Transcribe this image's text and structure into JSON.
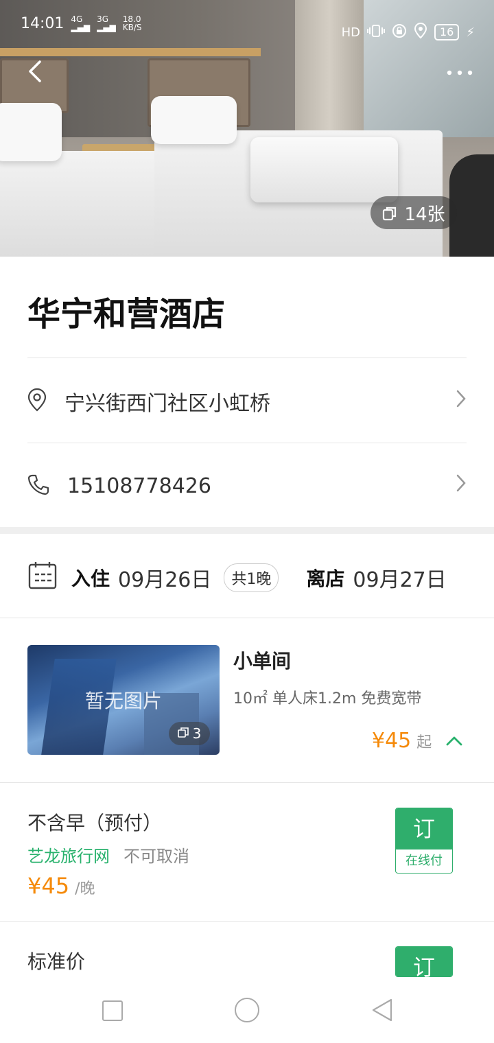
{
  "status_bar": {
    "time": "14:01",
    "signal1": "4G",
    "signal2": "3G",
    "speed": "18.0",
    "speed_unit": "KB/S",
    "hd": "HD",
    "battery": "16"
  },
  "hero": {
    "photo_count": "14张"
  },
  "hotel": {
    "name": "华宁和营酒店",
    "address": "宁兴街西门社区小虹桥",
    "phone": "15108778426"
  },
  "stay": {
    "checkin_label": "入住",
    "checkin_date": "09月26日",
    "nights": "共1晚",
    "checkout_label": "离店",
    "checkout_date": "09月27日"
  },
  "room": {
    "no_image_text": "暂无图片",
    "image_count": "3",
    "name": "小单间",
    "description": "10㎡ 单人床1.2m 免费宽带",
    "price": "¥45",
    "price_suffix": "起"
  },
  "plans": [
    {
      "name": "不含早（预付）",
      "provider": "艺龙旅行网",
      "cancel_policy": "不可取消",
      "price": "¥45",
      "price_unit": "/晚",
      "book_label": "订",
      "book_sub": "在线付"
    },
    {
      "name": "标准价",
      "book_label": "订"
    }
  ],
  "colors": {
    "accent_green": "#2fae6c",
    "price_orange": "#f58a0a"
  }
}
